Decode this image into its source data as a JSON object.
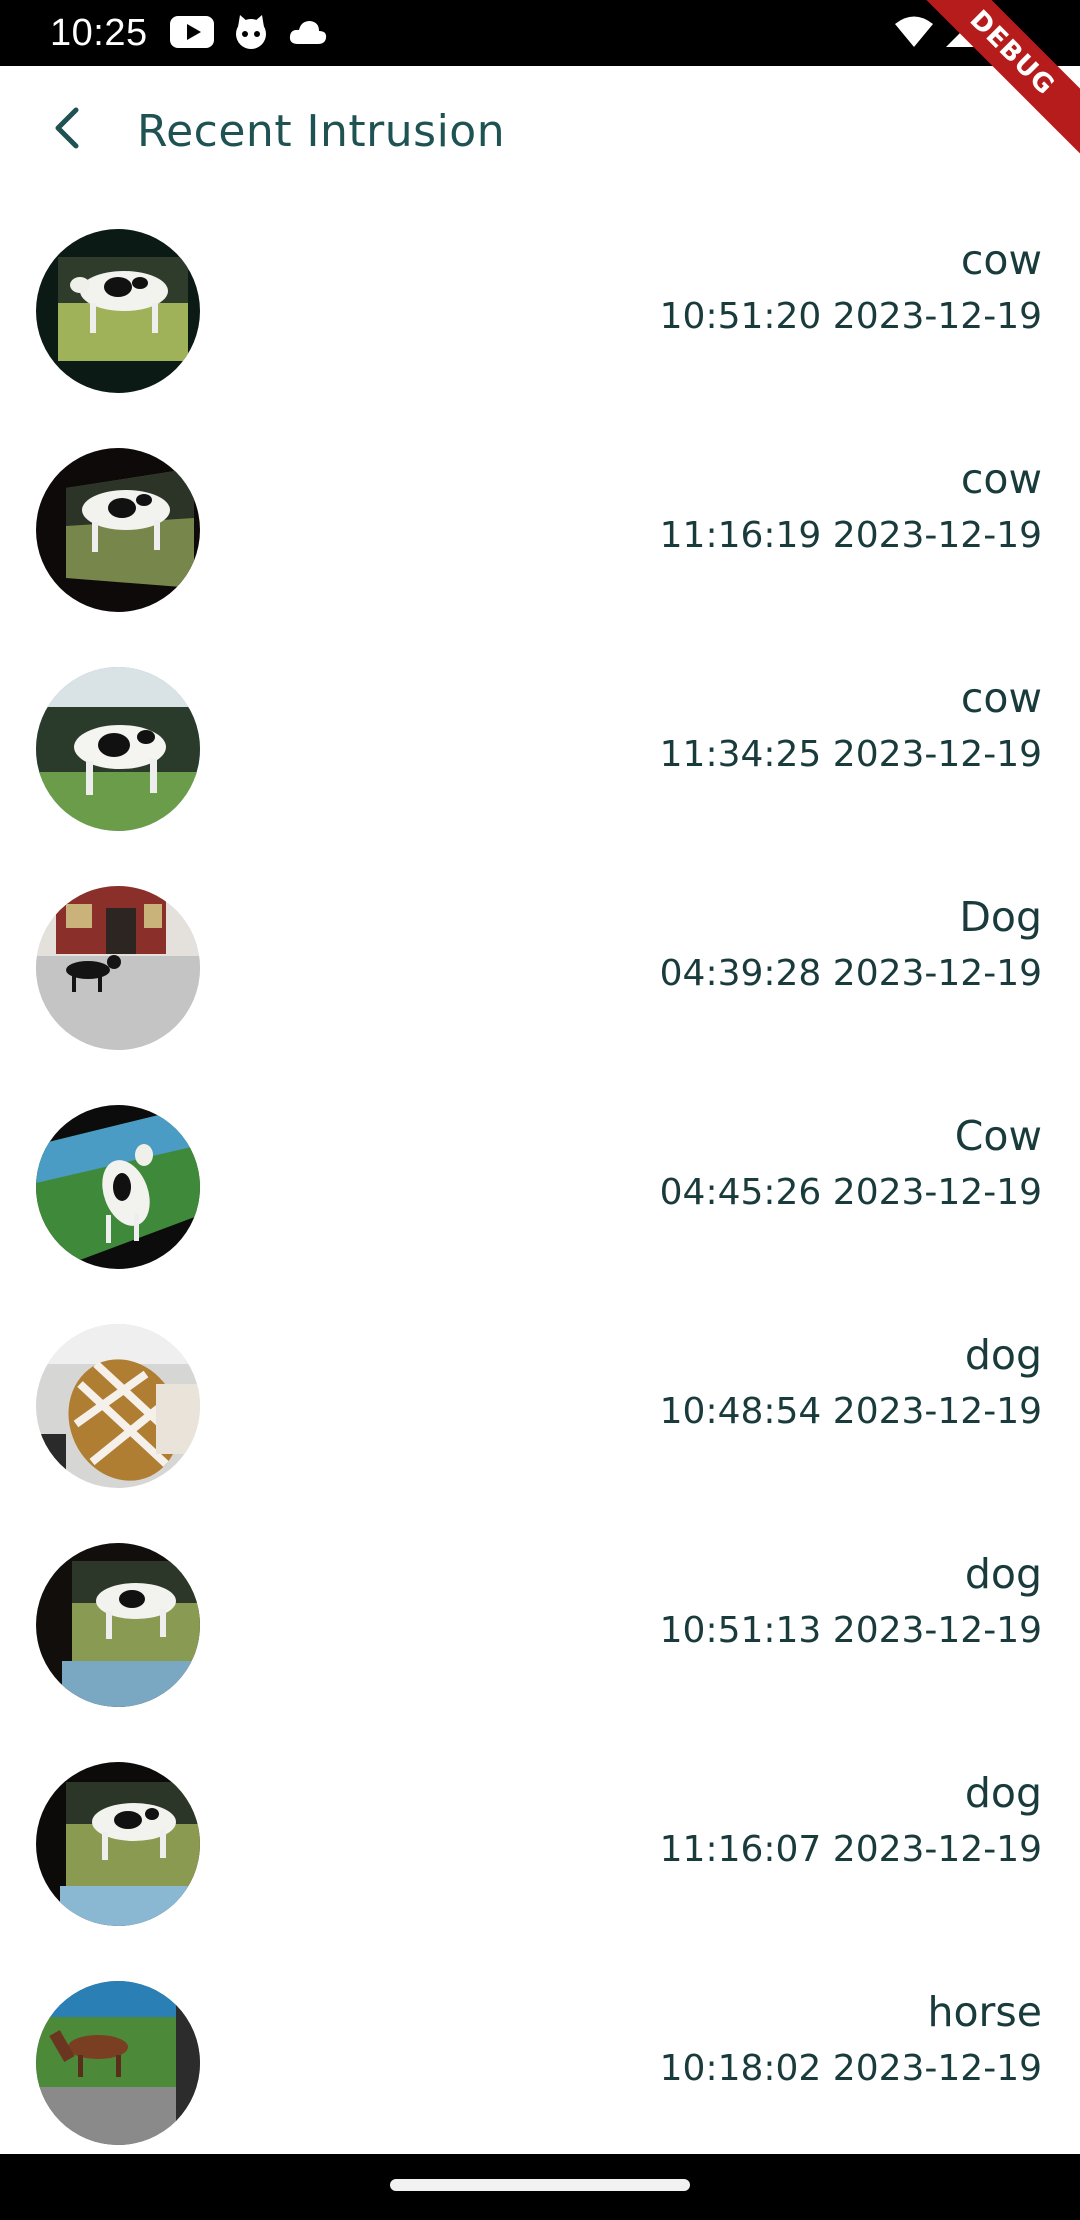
{
  "status_bar": {
    "time": "10:25",
    "left_icons": [
      "youtube-icon",
      "cat-icon",
      "cloud-icon"
    ],
    "right_icons": [
      "wifi-icon",
      "signal-icon",
      "battery-icon"
    ]
  },
  "debug_banner": "DEBUG",
  "app_bar": {
    "title": "Recent Intrusion",
    "back_icon": "chevron-left-icon"
  },
  "colors": {
    "title": "#1f5252",
    "text": "#1a3b3b",
    "debug": "#b71c1c"
  },
  "intrusions": [
    {
      "label": "cow",
      "time": "10:51:20 2023-12-19",
      "thumb": "cow"
    },
    {
      "label": "cow",
      "time": "11:16:19 2023-12-19",
      "thumb": "cow"
    },
    {
      "label": "cow",
      "time": "11:34:25 2023-12-19",
      "thumb": "cow-bright"
    },
    {
      "label": "Dog",
      "time": "04:39:28 2023-12-19",
      "thumb": "dog-street"
    },
    {
      "label": "Cow",
      "time": "04:45:26 2023-12-19",
      "thumb": "cow-tilted"
    },
    {
      "label": "dog",
      "time": "10:48:54 2023-12-19",
      "thumb": "hand"
    },
    {
      "label": "dog",
      "time": "10:51:13 2023-12-19",
      "thumb": "cow"
    },
    {
      "label": "dog",
      "time": "11:16:07 2023-12-19",
      "thumb": "cow"
    },
    {
      "label": "horse",
      "time": "10:18:02 2023-12-19",
      "thumb": "horse"
    }
  ]
}
